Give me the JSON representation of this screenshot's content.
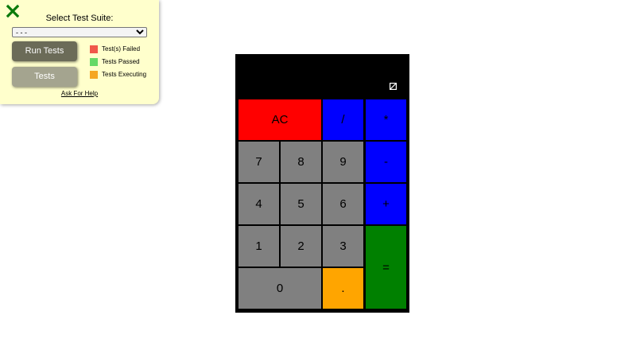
{
  "test_panel": {
    "close_icon": "close-x-icon",
    "close_color": "#0a7a0a",
    "title": "Select Test Suite:",
    "selected_suite": "- - -",
    "run_tests_label": "Run Tests",
    "tests_label": "Tests",
    "legend": [
      {
        "label": "Test(s) Failed",
        "color": "#f0584a"
      },
      {
        "label": "Tests Passed",
        "color": "#66d966"
      },
      {
        "label": "Tests Executing",
        "color": "#f5a623"
      }
    ],
    "help_link": "Ask For Help"
  },
  "calculator": {
    "display_icon": "empty-set-glyph-icon",
    "keys": {
      "clear": "AC",
      "divide": "/",
      "multiply": "*",
      "seven": "7",
      "eight": "8",
      "nine": "9",
      "subtract": "-",
      "four": "4",
      "five": "5",
      "six": "6",
      "add": "+",
      "one": "1",
      "two": "2",
      "three": "3",
      "equals": "=",
      "zero": "0",
      "decimal": "."
    }
  }
}
